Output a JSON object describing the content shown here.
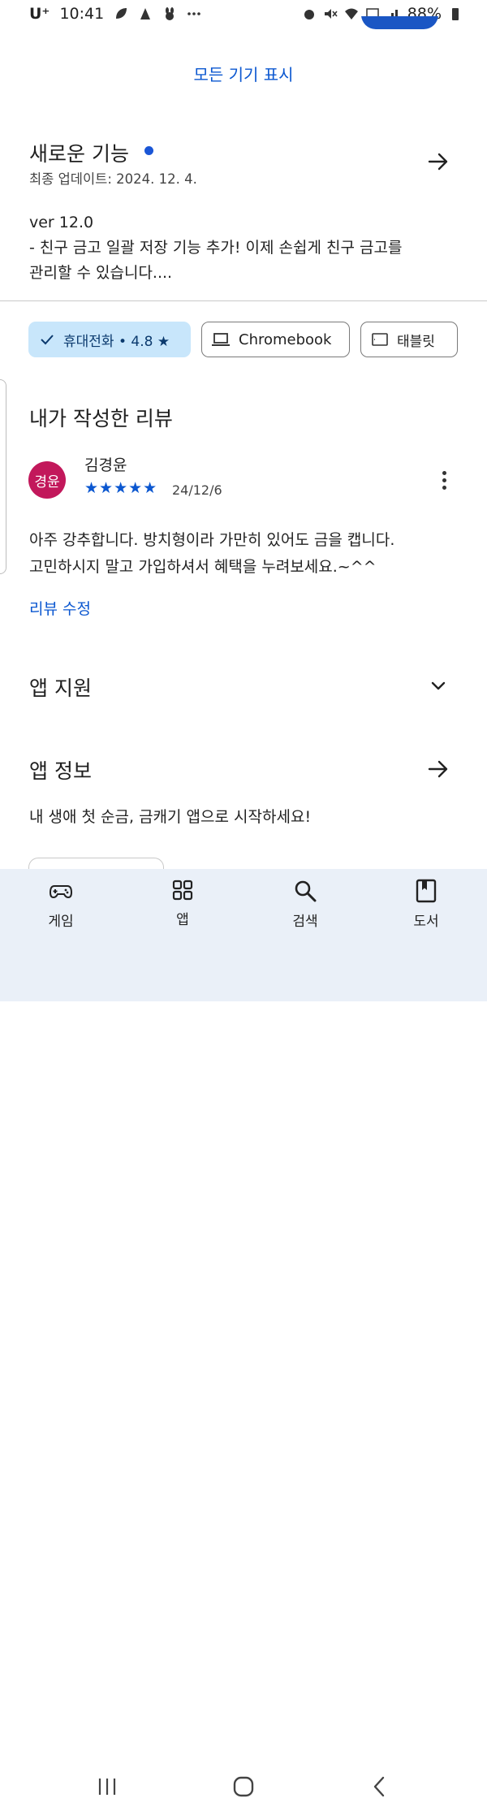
{
  "status_bar": {
    "carrier": "U⁺",
    "time": "10:41",
    "battery": "88%",
    "icons": [
      "leaf-icon",
      "app-notification-icon",
      "rabbit-icon",
      "more-notifications-icon",
      "alarm-icon",
      "mute-icon",
      "wifi-icon",
      "lte-icon",
      "signal-icon",
      "battery-icon"
    ]
  },
  "show_all_devices": "모든 기기 표시",
  "whats_new": {
    "title": "새로운 기능",
    "updated": "최종 업데이트: 2024. 12. 4.",
    "version": "ver 12.0",
    "note_line1": "- 친구 금고 일괄 저장 기능 추가! 이제 손쉽게 친구 금고를",
    "note_line2": "관리할 수 있습니다...."
  },
  "device_chips": {
    "phone": "휴대전화 • 4.8 ★",
    "chromebook": "Chromebook",
    "tablet": "태블릿"
  },
  "my_review": {
    "title": "내가 작성한 리뷰",
    "avatar_text": "경윤",
    "reviewer": "김경윤",
    "stars": "★★★★★",
    "rating": 5,
    "date": "24/12/6",
    "text_line1": "아주 강추합니다. 방치형이라 가만히 있어도 금을 캡니다.",
    "text_line2": "고민하시지 말고 가입하셔서 혜택을 누려보세요.~^^",
    "edit_label": "리뷰 수정"
  },
  "app_support": {
    "title": "앱 지원"
  },
  "app_info": {
    "title": "앱 정보",
    "description": "내 생애 첫 순금, 금캐기 앱으로 시작하세요!"
  },
  "bottom_nav": {
    "items": [
      {
        "label": "게임",
        "icon": "gamepad-icon"
      },
      {
        "label": "앱",
        "icon": "apps-grid-icon"
      },
      {
        "label": "검색",
        "icon": "search-icon"
      },
      {
        "label": "도서",
        "icon": "book-icon"
      }
    ]
  },
  "colors": {
    "accent": "#0b57d0",
    "chip_selected_bg": "#c8e6fb",
    "avatar_bg": "#c2185b",
    "nav_bg": "#eaf0f8"
  }
}
